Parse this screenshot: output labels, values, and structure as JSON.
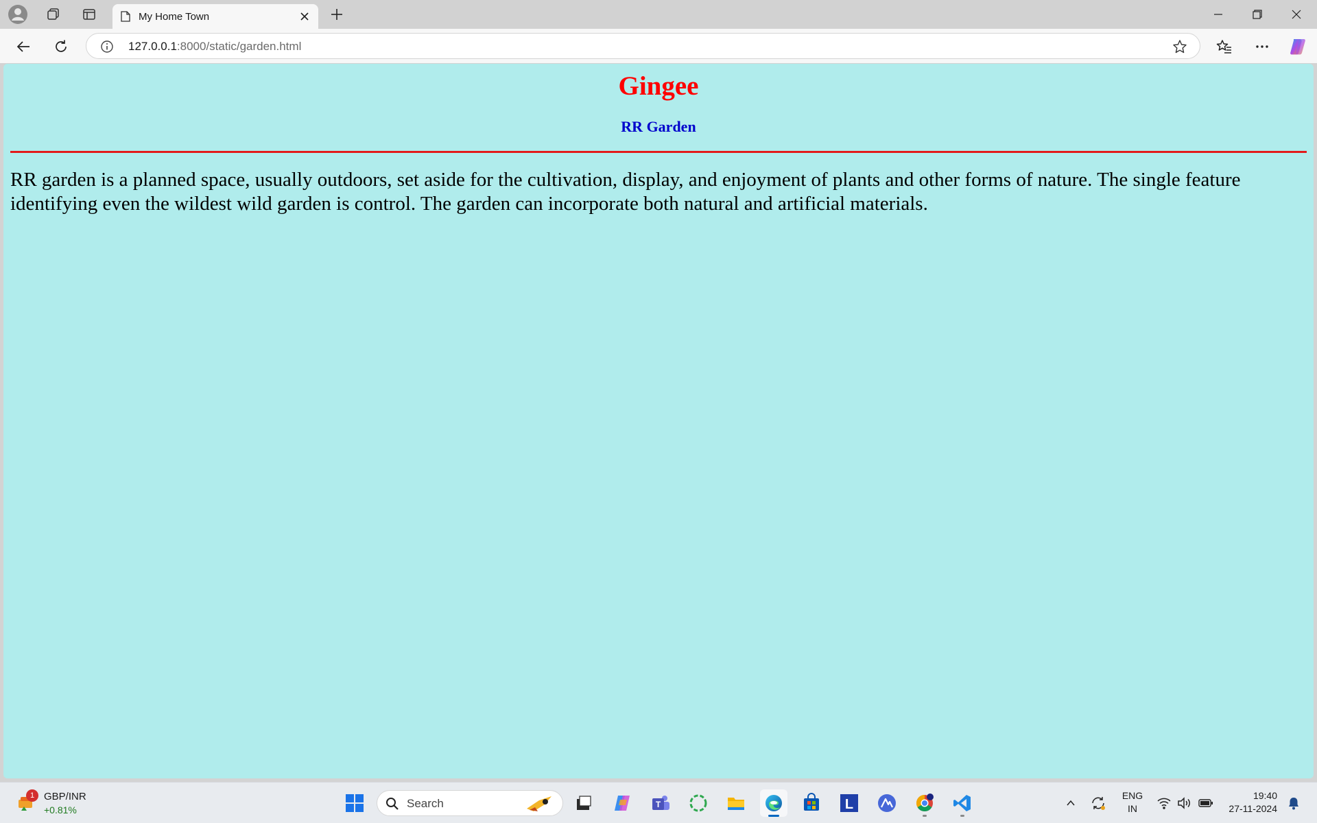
{
  "browser": {
    "tab": {
      "title": "My Home Town"
    },
    "address": {
      "host": "127.0.0.1",
      "rest": ":8000/static/garden.html"
    }
  },
  "page": {
    "heading": "Gingee",
    "subheading": "RR Garden",
    "paragraph": "RR garden is a planned space, usually outdoors, set aside for the cultivation, display, and enjoyment of plants and other forms of nature. The single feature identifying even the wildest wild garden is control. The garden can incorporate both natural and artificial materials.",
    "background_color": "#b0ecec",
    "heading_color": "#ff0000",
    "subheading_color": "#0000cc",
    "rule_color": "#e21b1b"
  },
  "taskbar": {
    "widget": {
      "title": "GBP/INR",
      "value": "+0.81%",
      "badge": "1"
    },
    "search": {
      "label": "Search"
    },
    "tray": {
      "lang_line1": "ENG",
      "lang_line2": "IN",
      "time": "19:40",
      "date": "27-11-2024"
    }
  }
}
